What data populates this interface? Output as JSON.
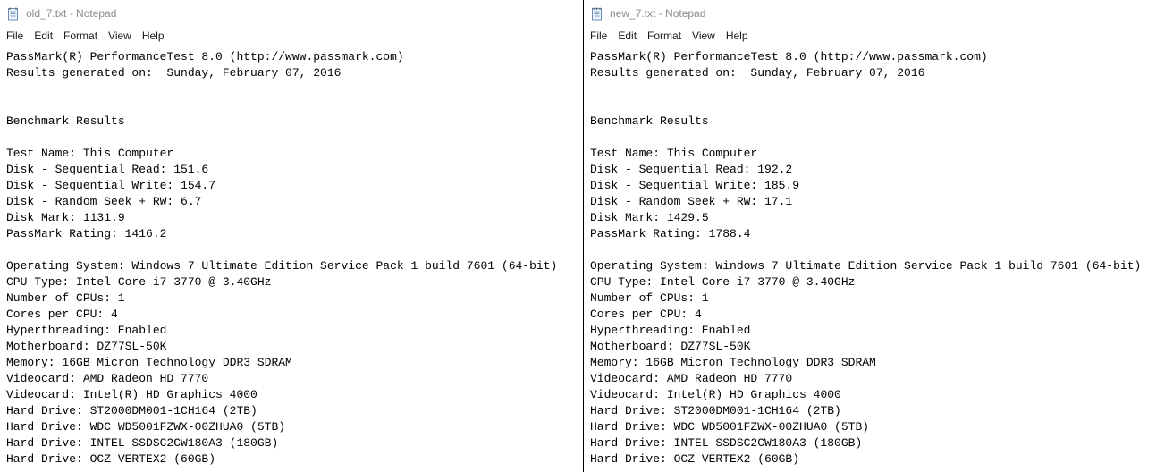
{
  "menu": [
    "File",
    "Edit",
    "Format",
    "View",
    "Help"
  ],
  "windows": [
    {
      "title": "old_7.txt - Notepad",
      "lines": [
        "PassMark(R) PerformanceTest 8.0 (http://www.passmark.com)",
        "Results generated on:  Sunday, February 07, 2016",
        "",
        "",
        "Benchmark Results",
        "",
        "Test Name: This Computer",
        "Disk - Sequential Read: 151.6",
        "Disk - Sequential Write: 154.7",
        "Disk - Random Seek + RW: 6.7",
        "Disk Mark: 1131.9",
        "PassMark Rating: 1416.2",
        "",
        "Operating System: Windows 7 Ultimate Edition Service Pack 1 build 7601 (64-bit)",
        "CPU Type: Intel Core i7-3770 @ 3.40GHz",
        "Number of CPUs: 1",
        "Cores per CPU: 4",
        "Hyperthreading: Enabled",
        "Motherboard: DZ77SL-50K",
        "Memory: 16GB Micron Technology DDR3 SDRAM",
        "Videocard: AMD Radeon HD 7770",
        "Videocard: Intel(R) HD Graphics 4000",
        "Hard Drive: ST2000DM001-1CH164 (2TB)",
        "Hard Drive: WDC WD5001FZWX-00ZHUA0 (5TB)",
        "Hard Drive: INTEL SSDSC2CW180A3 (180GB)",
        "Hard Drive: OCZ-VERTEX2 (60GB)"
      ]
    },
    {
      "title": "new_7.txt - Notepad",
      "lines": [
        "PassMark(R) PerformanceTest 8.0 (http://www.passmark.com)",
        "Results generated on:  Sunday, February 07, 2016",
        "",
        "",
        "Benchmark Results",
        "",
        "Test Name: This Computer",
        "Disk - Sequential Read: 192.2",
        "Disk - Sequential Write: 185.9",
        "Disk - Random Seek + RW: 17.1",
        "Disk Mark: 1429.5",
        "PassMark Rating: 1788.4",
        "",
        "Operating System: Windows 7 Ultimate Edition Service Pack 1 build 7601 (64-bit)",
        "CPU Type: Intel Core i7-3770 @ 3.40GHz",
        "Number of CPUs: 1",
        "Cores per CPU: 4",
        "Hyperthreading: Enabled",
        "Motherboard: DZ77SL-50K",
        "Memory: 16GB Micron Technology DDR3 SDRAM",
        "Videocard: AMD Radeon HD 7770",
        "Videocard: Intel(R) HD Graphics 4000",
        "Hard Drive: ST2000DM001-1CH164 (2TB)",
        "Hard Drive: WDC WD5001FZWX-00ZHUA0 (5TB)",
        "Hard Drive: INTEL SSDSC2CW180A3 (180GB)",
        "Hard Drive: OCZ-VERTEX2 (60GB)"
      ]
    }
  ],
  "icon": "notepad-icon",
  "colors": {
    "title_text": "#8c8c8c",
    "editor_border": "#d4d4d4"
  }
}
